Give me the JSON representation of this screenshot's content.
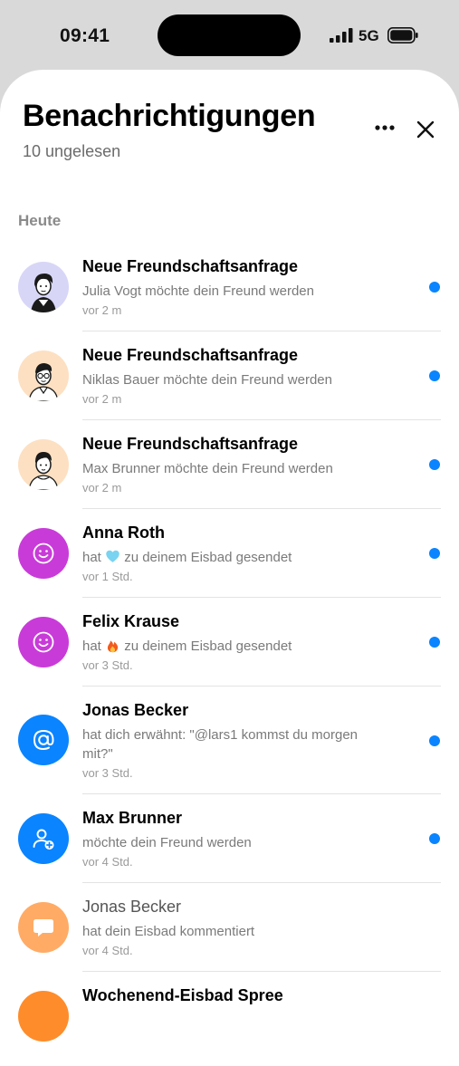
{
  "status_bar": {
    "time": "09:41",
    "network": "5G"
  },
  "header": {
    "title": "Benachrichtigungen",
    "subtitle": "10 ungelesen"
  },
  "section_label": "Heute",
  "colors": {
    "unread_dot": "#0a84ff",
    "purple": "#c93bd9",
    "blue": "#0a84ff",
    "orange": "#ffab66",
    "peach": "#fde0c2",
    "lavender": "#d8d6f7"
  },
  "notifications": [
    {
      "name": "Neue Freundschaftsanfrage",
      "msg": "Julia Vogt möchte dein Freund werden",
      "when": "vor 2 m",
      "avatar": "illustrated-woman-avatar",
      "unread": true
    },
    {
      "name": "Neue Freundschaftsanfrage",
      "msg": "Niklas Bauer möchte dein Freund werden",
      "when": "vor 2 m",
      "avatar": "illustrated-man-glasses-avatar",
      "unread": true
    },
    {
      "name": "Neue Freundschaftsanfrage",
      "msg": "Max Brunner möchte dein Freund werden",
      "when": "vor 2 m",
      "avatar": "illustrated-man-avatar",
      "unread": true
    },
    {
      "name": "Anna Roth",
      "msg_pre": "hat",
      "emoji": "light-blue-heart",
      "msg_post": "zu deinem Eisbad gesendet",
      "when": "vor 1 Std.",
      "avatar": "smiley-icon",
      "unread": true
    },
    {
      "name": "Felix Krause",
      "msg_pre": "hat",
      "emoji": "fire",
      "msg_post": "zu deinem Eisbad gesendet",
      "when": "vor 3 Std.",
      "avatar": "smiley-icon",
      "unread": true
    },
    {
      "name": "Jonas Becker",
      "msg": "hat dich erwähnt: \"@lars1 kommst du morgen mit?\"",
      "when": "vor 3 Std.",
      "avatar": "at-sign-icon",
      "unread": true
    },
    {
      "name": "Max Brunner",
      "msg": "möchte dein Freund werden",
      "when": "vor 4 Std.",
      "avatar": "add-user-icon",
      "unread": true
    },
    {
      "name": "Jonas Becker",
      "msg": "hat dein Eisbad kommentiert",
      "when": "vor 4 Std.",
      "avatar": "comment-icon",
      "unread": false
    },
    {
      "name": "Wochenend-Eisbad Spree",
      "avatar": "orange-event-icon",
      "unread": false
    }
  ]
}
